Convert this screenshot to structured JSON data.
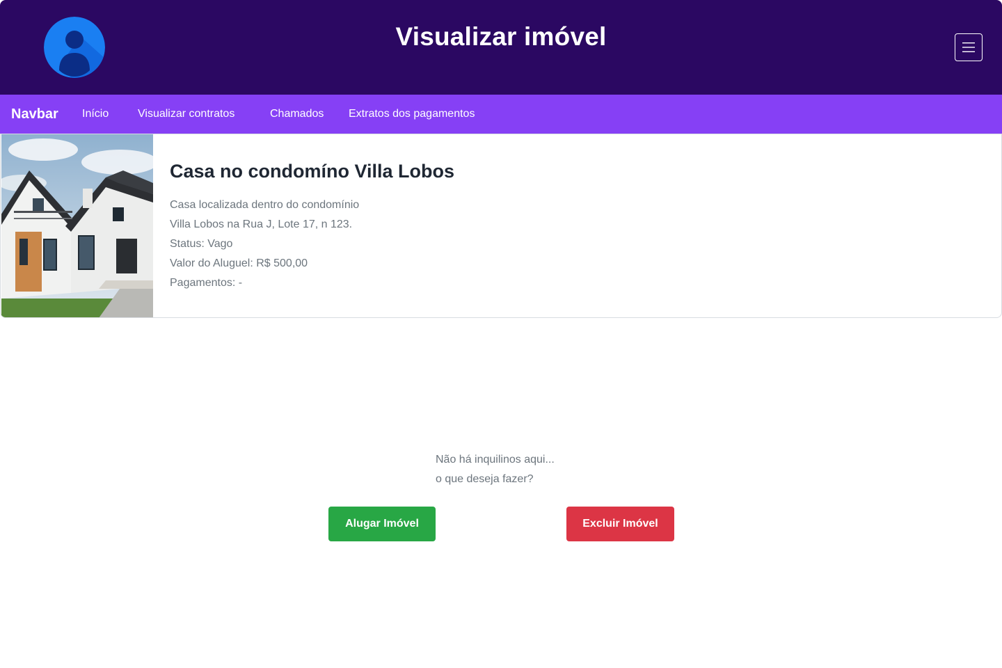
{
  "header": {
    "title": "Visualizar imóvel",
    "avatar_icon": "user-avatar-icon",
    "menu_icon": "hamburger-menu-icon"
  },
  "navbar": {
    "brand": "Navbar",
    "links": [
      {
        "label": "Início"
      },
      {
        "label": "Visualizar contratos"
      },
      {
        "label": "Chamados"
      },
      {
        "label": "Extratos dos pagamentos"
      }
    ]
  },
  "property": {
    "title": "Casa no condomíno Villa Lobos",
    "description_line1": "Casa localizada dentro do condomínio",
    "description_line2": "Villa Lobos na Rua J, Lote 17, n 123.",
    "status": "Status: Vago",
    "rent": "Valor do Aluguel: R$ 500,00",
    "payments": "Pagamentos: -"
  },
  "empty_state": {
    "line1": "Não há inquilinos aqui...",
    "line2": "o que deseja fazer?"
  },
  "actions": {
    "rent_label": "Alugar Imóvel",
    "delete_label": "Excluir Imóvel"
  },
  "colors": {
    "header_bg": "#2b0862",
    "navbar_bg": "#8640f5",
    "rent_button": "#28a745",
    "delete_button": "#dc3545"
  }
}
